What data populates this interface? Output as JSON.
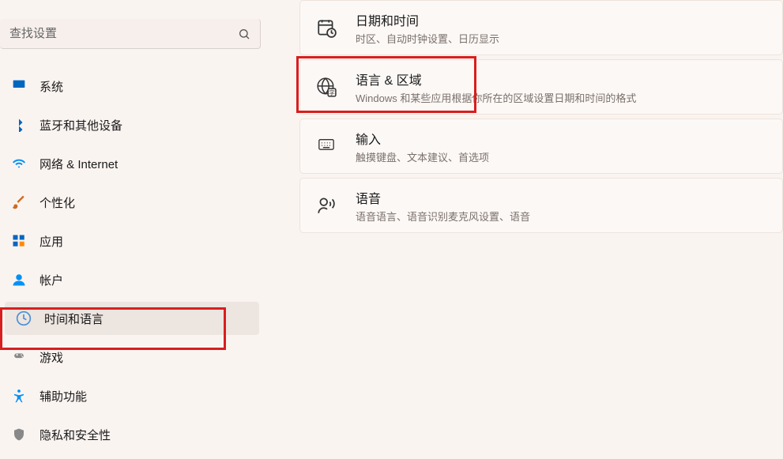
{
  "search": {
    "placeholder": "查找设置"
  },
  "sidebar": {
    "items": [
      {
        "label": "系统"
      },
      {
        "label": "蓝牙和其他设备"
      },
      {
        "label": "网络 & Internet"
      },
      {
        "label": "个性化"
      },
      {
        "label": "应用"
      },
      {
        "label": "帐户"
      },
      {
        "label": "时间和语言"
      },
      {
        "label": "游戏"
      },
      {
        "label": "辅助功能"
      },
      {
        "label": "隐私和安全性"
      }
    ]
  },
  "main": {
    "cards": [
      {
        "title": "日期和时间",
        "desc": "时区、自动时钟设置、日历显示"
      },
      {
        "title": "语言 & 区域",
        "desc": "Windows 和某些应用根据你所在的区域设置日期和时间的格式"
      },
      {
        "title": "输入",
        "desc": "触摸键盘、文本建议、首选项"
      },
      {
        "title": "语音",
        "desc": "语音语言、语音识别麦克风设置、语音"
      }
    ]
  }
}
